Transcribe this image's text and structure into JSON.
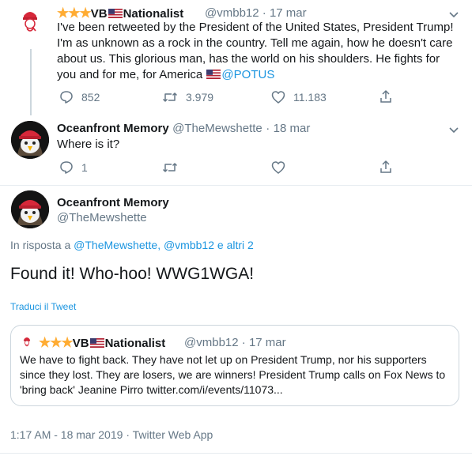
{
  "tweet1": {
    "stars": "★★★",
    "name_prefix": "VB",
    "name_suffix": "Nationalist",
    "handle": "@vmbb12",
    "separator": "·",
    "date": "17 mar",
    "text": "I've been retweeted by the President of the United States, President Trump! I'm as unknown as a rock in the country. Tell me again, how he doesn't care about us. This glorious man, has the world on his shoulders. He fights for you and for me, for America",
    "mention": "@POTUS",
    "replies": "852",
    "retweets": "3.979",
    "likes": "11.183"
  },
  "tweet2": {
    "name": "Oceanfront Memory",
    "handle": "@TheMewshette",
    "separator": "·",
    "date": "18 mar",
    "text": "Where is it?",
    "replies": "1"
  },
  "main": {
    "name": "Oceanfront Memory",
    "handle": "@TheMewshette",
    "reply_prefix": "In risposta a",
    "reply_to_1": "@TheMewshette,",
    "reply_to_2": "@vmbb12",
    "reply_and": "e",
    "reply_others": "altri 2",
    "text": "Found it! Who-hoo! WWG1WGA!",
    "translate": "Traduci il Tweet",
    "footer_time": "1:17 AM - 18 mar 2019",
    "footer_sep": "·",
    "footer_app": "Twitter Web App"
  },
  "quote": {
    "stars": "★★★",
    "name_prefix": "VB",
    "name_suffix": "Nationalist",
    "handle": "@vmbb12",
    "separator": "·",
    "date": "17 mar",
    "text": "We have to fight back. They have not let up on President Trump, nor his supporters since they lost. They are losers, we are winners! President Trump calls on Fox News to 'bring back' Jeanine Pirro  twitter.com/i/events/11073..."
  },
  "colors": {
    "link": "#1b95e0",
    "muted": "#657786",
    "star": "#ffac33",
    "text": "#14171a"
  },
  "icons": [
    "chevron-down-icon",
    "reply-icon",
    "retweet-icon",
    "like-icon",
    "share-icon",
    "us-flag-icon",
    "star-icon"
  ]
}
